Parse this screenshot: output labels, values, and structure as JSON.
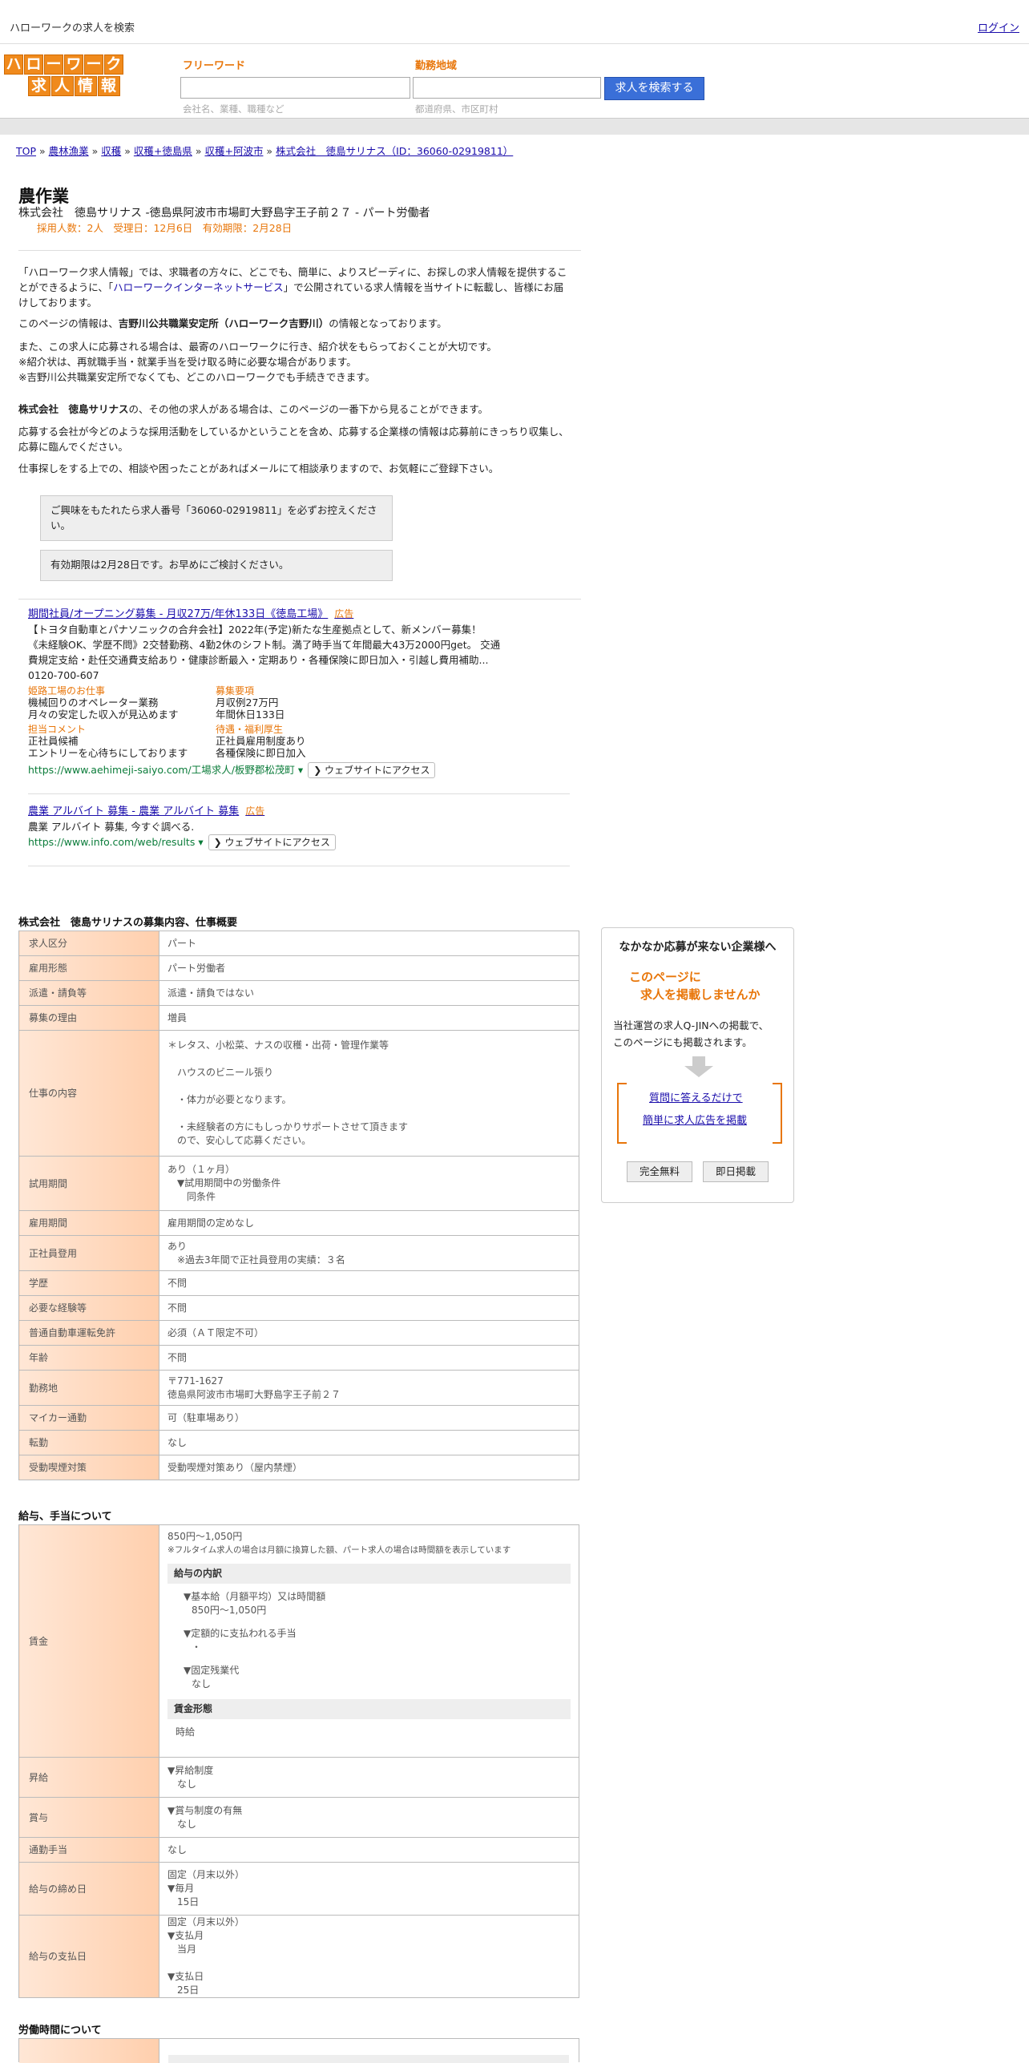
{
  "header": {
    "site_title": "ハローワークの求人を検索",
    "login": "ログイン",
    "logo_top": [
      "ハ",
      "ロ",
      "ー",
      "ワ",
      "ー",
      "ク"
    ],
    "logo_bottom": [
      "求",
      "人",
      "情",
      "報"
    ],
    "freeword_label": "フリーワード",
    "freeword_placeholder": "会社名、業種、職種など",
    "area_label": "勤務地域",
    "area_placeholder": "都道府県、市区町村",
    "search_button": "求人を検索する"
  },
  "breadcrumb": [
    "TOP",
    "農林漁業",
    "収穫",
    "収穫+徳島県",
    "収穫+阿波市",
    "株式会社　徳島サリナス（ID：36060-02919811）"
  ],
  "job": {
    "title": "農作業",
    "subtitle": "株式会社　徳島サリナス -徳島県阿波市市場町大野島字王子前２７ - パート労働者",
    "meta": "採用人数：2人　受理日：12月6日　有効期限：2月28日"
  },
  "intro": {
    "p1_a": "「ハローワーク求人情報」では、求職者の方々に、どこでも、簡単に、よりスピーディに、お探しの求人情報を提供することができるように、「",
    "p1_link": "ハローワークインターネットサービス",
    "p1_b": "」で公開されている求人情報を当サイトに転載し、皆様にお届けしております。",
    "p2_a": "このページの情報は、",
    "p2_bold": "吉野川公共職業安定所（ハローワーク吉野川）",
    "p2_b": "の情報となっております。",
    "p3": [
      "また、この求人に応募される場合は、最寄のハローワークに行き、紹介状をもらっておくことが大切です。",
      "※紹介状は、再就職手当・就業手当を受け取る時に必要な場合があります。",
      "※吉野川公共職業安定所でなくても、どこのハローワークでも手続きできます。"
    ],
    "p4_bold": "株式会社　徳島サリナス",
    "p4": "の、その他の求人がある場合は、このページの一番下から見ることができます。",
    "p5": "応募する会社が今どのような採用活動をしているかということを含め、応募する企業様の情報は応募前にきっちり収集し、応募に臨んでください。",
    "p6": "仕事探しをする上での、相談や困ったことがあればメールにて相談承りますので、お気軽にご登録下さい。",
    "note1": "ご興味をもたれたら求人番号「36060-02919811」を必ずお控えください。",
    "note2": "有効期限は2月28日です。お早めにご検討ください。"
  },
  "ads": [
    {
      "title": "期間社員/オープニング募集 - 月収27万/年休133日《徳島工場》",
      "badge": "広告",
      "lines": [
        "【トヨタ自動車とパナソニックの合弁会社】2022年(予定)新たな生産拠点として、新メンバー募集！",
        "《未経験OK、学歴不問》2交替勤務、4勤2休のシフト制。満了時手当て年間最大43万2000円get。 交通",
        "費規定支給・赴任交通費支給あり・健康診断最入・定期あり・各種保険に即日加入・引越し費用補助...",
        "0120-700-607"
      ],
      "sub": [
        {
          "label": "姫路工場のお仕事",
          "lines": [
            "機械回りのオペレーター業務",
            "月々の安定した収入が見込めます"
          ]
        },
        {
          "label": "募集要項",
          "lines": [
            "月収例27万円",
            "年間休日133日"
          ]
        },
        {
          "label": "担当コメント",
          "lines": [
            "正社員候補",
            "エントリーを心待ちにしております"
          ]
        },
        {
          "label": "待遇・福利厚生",
          "lines": [
            "正社員雇用制度あり",
            "各種保険に即日加入"
          ]
        }
      ],
      "url": "https://www.aehimeji-saiyo.com/工場求人/板野郡松茂町 ▾",
      "chip": "❯ ウェブサイトにアクセス"
    },
    {
      "title": "農業 アルバイト 募集 - 農業 アルバイト 募集",
      "badge": "広告",
      "lines": [
        "農業 アルバイト 募集, 今すぐ調べる."
      ],
      "url": "https://www.info.com/web/results ▾",
      "chip": "❯ ウェブサイトにアクセス"
    }
  ],
  "recruit_section_title": "株式会社　徳島サリナスの募集内容、仕事概要",
  "recruit_rows": [
    {
      "h": "求人区分",
      "v": [
        "パート"
      ]
    },
    {
      "h": "雇用形態",
      "v": [
        "パート労働者"
      ]
    },
    {
      "h": "派遣・請負等",
      "v": [
        "派遣・請負ではない"
      ]
    },
    {
      "h": "募集の理由",
      "v": [
        "増員"
      ]
    },
    {
      "h": "仕事の内容",
      "v": [
        "＊レタス、小松菜、ナスの収穫・出荷・管理作業等",
        "",
        "　ハウスのビニール張り",
        "",
        "　・体力が必要となります。",
        "",
        "　・未経験者の方にもしっかりサポートさせて頂きます",
        "　ので、安心して応募ください。"
      ]
    },
    {
      "h": "試用期間",
      "v": [
        "あり（１ヶ月）",
        "　▼試用期間中の労働条件",
        "　　同条件"
      ]
    },
    {
      "h": "雇用期間",
      "v": [
        "雇用期間の定めなし"
      ]
    },
    {
      "h": "正社員登用",
      "v": [
        "あり",
        "　※過去3年間で正社員登用の実績：３名"
      ]
    },
    {
      "h": "学歴",
      "v": [
        "不問"
      ]
    },
    {
      "h": "必要な経験等",
      "v": [
        "不問"
      ]
    },
    {
      "h": "普通自動車運転免許",
      "v": [
        "必須（ＡＴ限定不可）"
      ]
    },
    {
      "h": "年齢",
      "v": [
        "不問"
      ]
    },
    {
      "h": "勤務地",
      "v": [
        "〒771-1627",
        "徳島県阿波市市場町大野島字王子前２７"
      ]
    },
    {
      "h": "マイカー通勤",
      "v": [
        "可（駐車場あり）"
      ]
    },
    {
      "h": "転勤",
      "v": [
        "なし"
      ]
    },
    {
      "h": "受動喫煙対策",
      "v": [
        "受動喫煙対策あり（屋内禁煙）"
      ]
    }
  ],
  "salary_section_title": "給与、手当について",
  "salary": {
    "wage_label": "賃金",
    "wage_value": "850円〜1,050円",
    "wage_note": "※フルタイム求人の場合は月額に換算した額、パート求人の場合は時間額を表示しています",
    "breakdown_title": "給与の内訳",
    "breakdown": [
      "▼基本給（月額平均）又は時間額",
      "850円〜1,050円",
      "▼定額的に支払われる手当",
      "・",
      "▼固定残業代",
      "なし"
    ],
    "form_title": "賃金形態",
    "form_value": "時給",
    "rows": [
      {
        "h": "昇給",
        "v": [
          "▼昇給制度",
          "　なし"
        ]
      },
      {
        "h": "賞与",
        "v": [
          "▼賞与制度の有無",
          "　なし"
        ]
      },
      {
        "h": "通勤手当",
        "v": [
          "なし"
        ]
      },
      {
        "h": "給与の締め日",
        "v": [
          "固定（月末以外）",
          "▼毎月",
          "　15日"
        ]
      },
      {
        "h": "給与の支払日",
        "v": [
          "固定（月末以外）",
          "▼支払月",
          "　当月",
          "",
          "▼支払日",
          "　25日"
        ]
      }
    ]
  },
  "hours_section_title": "労働時間について",
  "promo": {
    "title": "なかなか応募が来ない企業様へ",
    "hl1": "このページに",
    "hl2": "求人を掲載しませんか",
    "desc1": "当社運営の求人Q-JINへの掲載で、",
    "desc2": "このページにも掲載されます。",
    "link1": "質問に答えるだけで",
    "link2": "簡単に求人広告を掲載",
    "btn1": "完全無料",
    "btn2": "即日掲載"
  },
  "colors": {
    "accent": "#e8760a",
    "link": "#1a0dab",
    "search_btn": "#3a6fd8",
    "ad_url": "#0b7c3a"
  }
}
